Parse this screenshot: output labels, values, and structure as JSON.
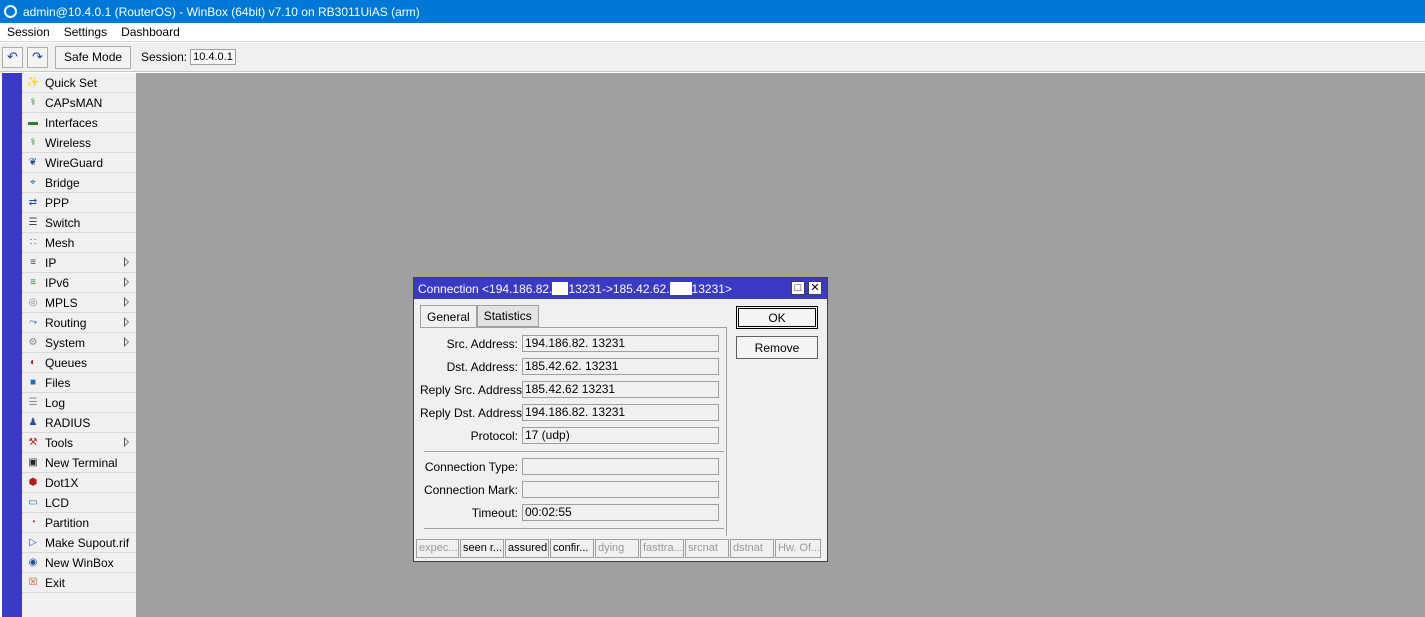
{
  "window": {
    "title": "admin@10.4.0.1 (RouterOS) - WinBox (64bit) v7.10 on RB3011UiAS (arm)"
  },
  "menu": {
    "items": [
      "Session",
      "Settings",
      "Dashboard"
    ]
  },
  "toolbar": {
    "undo_icon": "undo-icon",
    "redo_icon": "redo-icon",
    "safe_mode_label": "Safe Mode",
    "session_label": "Session:",
    "session_value": "10.4.0.1"
  },
  "sidebar": {
    "items": [
      {
        "label": "Quick Set",
        "icon": "wand-icon",
        "submenu": false
      },
      {
        "label": "CAPsMAN",
        "icon": "antenna-icon",
        "submenu": false
      },
      {
        "label": "Interfaces",
        "icon": "interface-icon",
        "submenu": false
      },
      {
        "label": "Wireless",
        "icon": "antenna-icon",
        "submenu": false
      },
      {
        "label": "WireGuard",
        "icon": "wireguard-icon",
        "submenu": false
      },
      {
        "label": "Bridge",
        "icon": "bridge-icon",
        "submenu": false
      },
      {
        "label": "PPP",
        "icon": "ppp-icon",
        "submenu": false
      },
      {
        "label": "Switch",
        "icon": "switch-icon",
        "submenu": false
      },
      {
        "label": "Mesh",
        "icon": "mesh-icon",
        "submenu": false
      },
      {
        "label": "IP",
        "icon": "ip-icon",
        "submenu": true
      },
      {
        "label": "IPv6",
        "icon": "ipv6-icon",
        "submenu": true
      },
      {
        "label": "MPLS",
        "icon": "mpls-icon",
        "submenu": true
      },
      {
        "label": "Routing",
        "icon": "routing-icon",
        "submenu": true
      },
      {
        "label": "System",
        "icon": "gear-icon",
        "submenu": true
      },
      {
        "label": "Queues",
        "icon": "queues-icon",
        "submenu": false
      },
      {
        "label": "Files",
        "icon": "folder-icon",
        "submenu": false
      },
      {
        "label": "Log",
        "icon": "log-icon",
        "submenu": false
      },
      {
        "label": "RADIUS",
        "icon": "radius-icon",
        "submenu": false
      },
      {
        "label": "Tools",
        "icon": "tools-icon",
        "submenu": true
      },
      {
        "label": "New Terminal",
        "icon": "terminal-icon",
        "submenu": false
      },
      {
        "label": "Dot1X",
        "icon": "dot1x-icon",
        "submenu": false
      },
      {
        "label": "LCD",
        "icon": "lcd-icon",
        "submenu": false
      },
      {
        "label": "Partition",
        "icon": "partition-icon",
        "submenu": false
      },
      {
        "label": "Make Supout.rif",
        "icon": "supout-icon",
        "submenu": false
      },
      {
        "label": "New WinBox",
        "icon": "winbox-icon",
        "submenu": false
      },
      {
        "label": "Exit",
        "icon": "exit-icon",
        "submenu": false
      }
    ]
  },
  "dialog": {
    "title_prefix": "Connection <194.186.82.",
    "title_mid": "13231->185.42.62.",
    "title_suffix": "13231>",
    "tabs": [
      "General",
      "Statistics"
    ],
    "active_tab": "General",
    "fields": [
      {
        "label": "Src. Address:",
        "value": "194.186.82.      13231"
      },
      {
        "label": "Dst. Address:",
        "value": "185.42.62.        13231"
      },
      {
        "label": "Reply Src. Address:",
        "value": "185.42.62          13231"
      },
      {
        "label": "Reply Dst. Address:",
        "value": "194.186.82.      13231"
      },
      {
        "label": "Protocol:",
        "value": "17 (udp)"
      },
      {
        "label": "Connection Type:",
        "value": ""
      },
      {
        "label": "Connection Mark:",
        "value": ""
      },
      {
        "label": "Timeout:",
        "value": "00:02:55"
      }
    ],
    "buttons": {
      "ok": "OK",
      "remove": "Remove"
    },
    "status": [
      {
        "text": "expec...",
        "active": false
      },
      {
        "text": "seen r...",
        "active": true
      },
      {
        "text": "assured",
        "active": true
      },
      {
        "text": "confir...",
        "active": true
      },
      {
        "text": "dying",
        "active": false
      },
      {
        "text": "fasttra...",
        "active": false
      },
      {
        "text": "srcnat",
        "active": false
      },
      {
        "text": "dstnat",
        "active": false
      },
      {
        "text": "Hw. Of...",
        "active": false
      }
    ]
  },
  "colors": {
    "titlebar": "#0078d7",
    "sidebar_strip": "#3a3ac6",
    "dialog_title": "#3a3ac6",
    "workspace": "#a0a0a0"
  }
}
